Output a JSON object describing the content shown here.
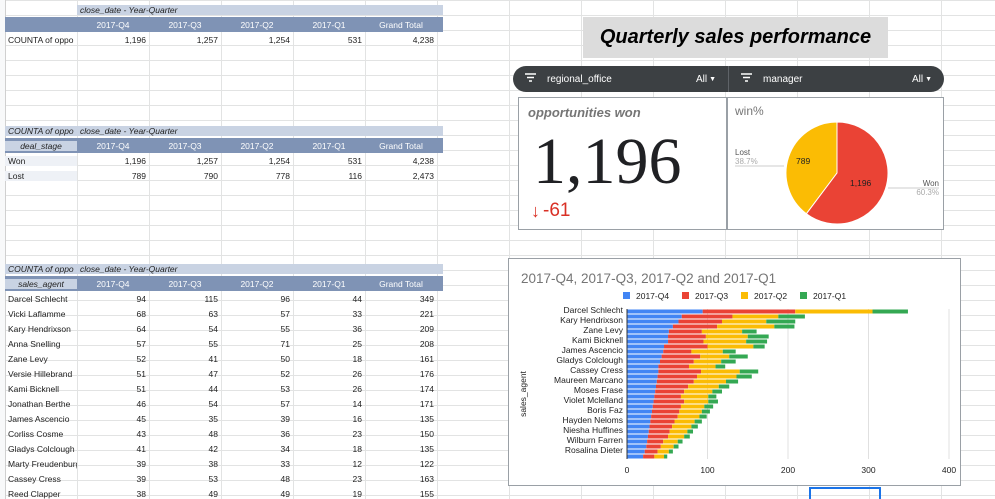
{
  "pivot_summary": {
    "meta": "close_date - Year-Quarter",
    "columns": [
      "2017-Q4",
      "2017-Q3",
      "2017-Q2",
      "2017-Q1",
      "Grand Total"
    ],
    "rows": [
      {
        "label": "COUNTA of oppo",
        "values": [
          "1,196",
          "1,257",
          "1,254",
          "531",
          "4,238"
        ]
      }
    ]
  },
  "pivot_stage": {
    "value_label": "COUNTA of oppo",
    "meta": "close_date - Year-Quarter",
    "row_header": "deal_stage",
    "columns": [
      "2017-Q4",
      "2017-Q3",
      "2017-Q2",
      "2017-Q1",
      "Grand Total"
    ],
    "rows": [
      {
        "label": "Won",
        "values": [
          "1,196",
          "1,257",
          "1,254",
          "531",
          "4,238"
        ]
      },
      {
        "label": "Lost",
        "values": [
          "789",
          "790",
          "778",
          "116",
          "2,473"
        ]
      }
    ]
  },
  "pivot_agent": {
    "value_label": "COUNTA of oppo",
    "meta": "close_date - Year-Quarter",
    "row_header": "sales_agent",
    "columns": [
      "2017-Q4",
      "2017-Q3",
      "2017-Q2",
      "2017-Q1",
      "Grand Total"
    ],
    "rows": [
      {
        "label": "Darcel Schlecht",
        "values": [
          "94",
          "115",
          "96",
          "44",
          "349"
        ]
      },
      {
        "label": "Vicki Laflamme",
        "values": [
          "68",
          "63",
          "57",
          "33",
          "221"
        ]
      },
      {
        "label": "Kary Hendrixson",
        "values": [
          "64",
          "54",
          "55",
          "36",
          "209"
        ]
      },
      {
        "label": "Anna Snelling",
        "values": [
          "57",
          "55",
          "71",
          "25",
          "208"
        ]
      },
      {
        "label": "Zane Levy",
        "values": [
          "52",
          "41",
          "50",
          "18",
          "161"
        ]
      },
      {
        "label": "Versie Hillebrand",
        "values": [
          "51",
          "47",
          "52",
          "26",
          "176"
        ]
      },
      {
        "label": "Kami Bicknell",
        "values": [
          "51",
          "44",
          "53",
          "26",
          "174"
        ]
      },
      {
        "label": "Jonathan Berthe",
        "values": [
          "46",
          "54",
          "57",
          "14",
          "171"
        ]
      },
      {
        "label": "James Ascencio",
        "values": [
          "45",
          "35",
          "39",
          "16",
          "135"
        ]
      },
      {
        "label": "Corliss Cosme",
        "values": [
          "43",
          "48",
          "36",
          "23",
          "150"
        ]
      },
      {
        "label": "Gladys Colclough",
        "values": [
          "41",
          "42",
          "34",
          "18",
          "135"
        ]
      },
      {
        "label": "Marty Freudenburg",
        "values": [
          "39",
          "38",
          "33",
          "12",
          "122"
        ]
      },
      {
        "label": "Cassey Cress",
        "values": [
          "39",
          "53",
          "48",
          "23",
          "163"
        ]
      },
      {
        "label": "Reed Clapper",
        "values": [
          "38",
          "49",
          "49",
          "19",
          "155"
        ]
      }
    ]
  },
  "dashboard": {
    "title": "Quarterly sales performance",
    "filters": [
      {
        "name": "regional_office",
        "value": "All"
      },
      {
        "name": "manager",
        "value": "All"
      }
    ],
    "scorecard": {
      "title": "opportunities won",
      "value": "1,196",
      "delta": "-61"
    },
    "pie": {
      "title": "win%",
      "lost_label": "Lost",
      "lost_pct": "38.7%",
      "lost_value": "789",
      "won_label": "Won",
      "won_pct": "60.3%",
      "won_value": "1,196",
      "colors": {
        "lost": "#fbbc04",
        "won": "#ea4335"
      }
    }
  },
  "colors": {
    "q4": "#4285f4",
    "q3": "#ea4335",
    "q2": "#fbbc04",
    "q1": "#34a853",
    "pivot_header": "#7f93b5",
    "pivot_meta": "#c9d3e3"
  },
  "chart_data": {
    "type": "bar",
    "orientation": "horizontal",
    "stacked": true,
    "title": "2017-Q4, 2017-Q3, 2017-Q2 and 2017-Q1",
    "ylabel": "sales_agent",
    "xlim": [
      0,
      400
    ],
    "xticks": [
      "0",
      "100",
      "200",
      "300",
      "400"
    ],
    "legend_position": "top",
    "categories": [
      "Darcel Schlecht",
      "",
      "Kary Hendrixson",
      "",
      "Zane Levy",
      "",
      "Kami Bicknell",
      "",
      "James Ascencio",
      "",
      "Gladys Colclough",
      "",
      "Cassey Cress",
      "",
      "Maureen Marcano",
      "",
      "Moses Frase",
      "",
      "Violet Mclelland",
      "",
      "Boris Faz",
      "",
      "Hayden Neloms",
      "",
      "Niesha Huffines",
      "",
      "Wilburn Farren",
      "",
      "Rosalina Dieter",
      ""
    ],
    "series": [
      {
        "name": "2017-Q4",
        "values": [
          94,
          68,
          64,
          57,
          52,
          51,
          51,
          46,
          45,
          43,
          41,
          39,
          39,
          38,
          37,
          36,
          35,
          34,
          33,
          32,
          31,
          30,
          29,
          28,
          27,
          26,
          25,
          24,
          22,
          20
        ]
      },
      {
        "name": "2017-Q3",
        "values": [
          115,
          63,
          54,
          55,
          41,
          47,
          44,
          54,
          35,
          48,
          42,
          38,
          53,
          49,
          46,
          40,
          36,
          33,
          38,
          35,
          34,
          33,
          30,
          28,
          26,
          25,
          20,
          18,
          16,
          14
        ]
      },
      {
        "name": "2017-Q2",
        "values": [
          96,
          57,
          55,
          71,
          50,
          52,
          53,
          57,
          39,
          36,
          34,
          33,
          48,
          49,
          40,
          38,
          35,
          34,
          30,
          29,
          28,
          27,
          25,
          24,
          22,
          20,
          18,
          16,
          14,
          12
        ]
      },
      {
        "name": "2017-Q1",
        "values": [
          44,
          33,
          36,
          25,
          18,
          26,
          26,
          14,
          16,
          23,
          18,
          12,
          23,
          19,
          15,
          13,
          12,
          10,
          12,
          11,
          10,
          9,
          9,
          8,
          7,
          7,
          6,
          6,
          5,
          4
        ]
      }
    ]
  }
}
